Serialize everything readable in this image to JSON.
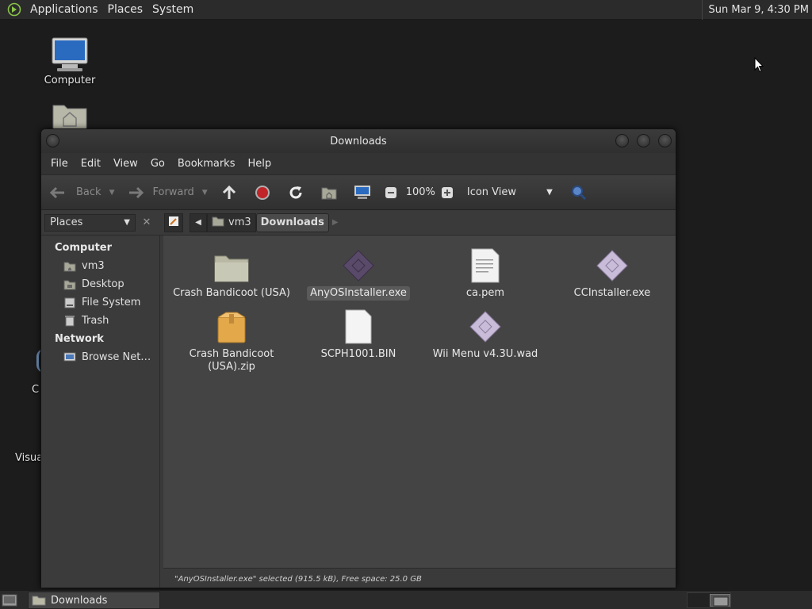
{
  "top_panel": {
    "menus": [
      "Applications",
      "Places",
      "System"
    ],
    "clock": "Sun Mar  9,  4:30 PM"
  },
  "desktop": {
    "icons": [
      {
        "label": "Computer",
        "icon": "computer-icon"
      },
      {
        "label": "",
        "icon": "home-folder-icon"
      }
    ],
    "partial_labels": [
      "C",
      "Visua"
    ]
  },
  "window": {
    "title": "Downloads",
    "menubar": [
      "File",
      "Edit",
      "View",
      "Go",
      "Bookmarks",
      "Help"
    ],
    "toolbar": {
      "back_label": "Back",
      "forward_label": "Forward",
      "zoom": "100%",
      "view_mode": "Icon View"
    },
    "location": {
      "places_select": "Places",
      "path": [
        "vm3",
        "Downloads"
      ]
    },
    "sidebar": {
      "sections": [
        {
          "title": "Computer",
          "items": [
            {
              "label": "vm3",
              "icon": "home-icon"
            },
            {
              "label": "Desktop",
              "icon": "desktop-icon"
            },
            {
              "label": "File System",
              "icon": "drive-icon"
            },
            {
              "label": "Trash",
              "icon": "trash-icon"
            }
          ]
        },
        {
          "title": "Network",
          "items": [
            {
              "label": "Browse Net…",
              "icon": "network-icon"
            }
          ]
        }
      ]
    },
    "files": [
      {
        "name": "Crash Bandicoot (USA)",
        "icon": "folder-icon",
        "selected": false
      },
      {
        "name": "AnyOSInstaller.exe",
        "icon": "executable-icon",
        "selected": true
      },
      {
        "name": "ca.pem",
        "icon": "text-file-icon",
        "selected": false
      },
      {
        "name": "CCInstaller.exe",
        "icon": "executable-icon",
        "selected": false
      },
      {
        "name": "Crash Bandicoot (USA).zip",
        "icon": "archive-icon",
        "selected": false
      },
      {
        "name": "SCPH1001.BIN",
        "icon": "file-icon",
        "selected": false
      },
      {
        "name": "Wii Menu v4.3U.wad",
        "icon": "executable-icon",
        "selected": false
      }
    ],
    "status": "\"AnyOSInstaller.exe\" selected (915.5 kB), Free space: 25.0 GB"
  },
  "taskbar": {
    "tasks": [
      {
        "label": "Downloads",
        "icon": "folder-icon"
      }
    ]
  }
}
